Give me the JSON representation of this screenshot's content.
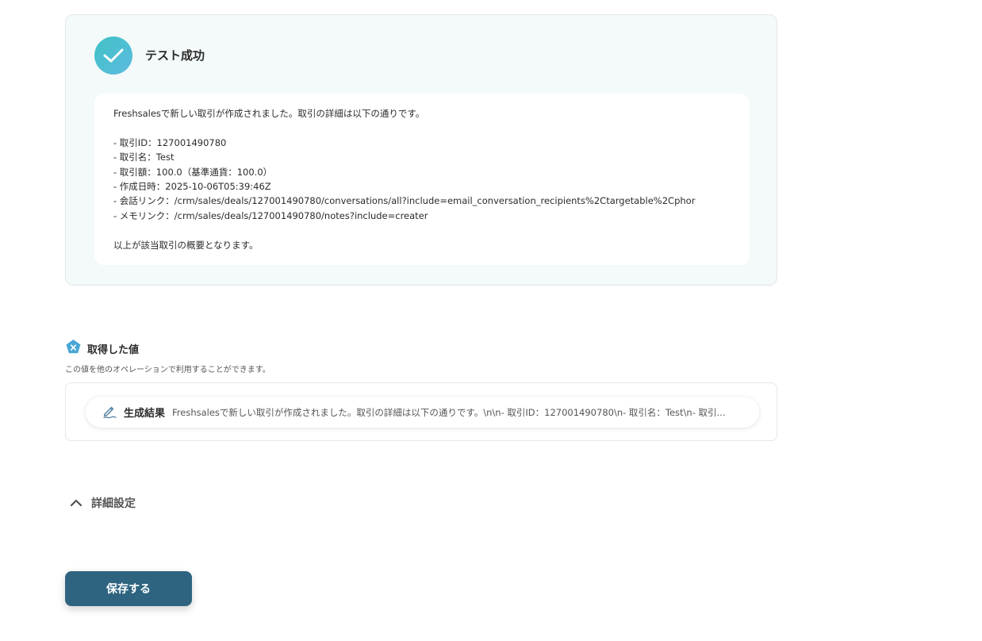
{
  "test_result": {
    "title": "テスト成功",
    "lines": [
      "Freshsalesで新しい取引が作成されました。取引の詳細は以下の通りです。",
      "",
      "- 取引ID：127001490780",
      "- 取引名：Test",
      "- 取引額：100.0（基準通貨：100.0）",
      "- 作成日時：2025-10-06T05:39:46Z",
      "- 会話リンク：/crm/sales/deals/127001490780/conversations/all?include=email_conversation_recipients%2Ctargetable%2Cphor",
      "- メモリンク：/crm/sales/deals/127001490780/notes?include=creater",
      "",
      "以上が該当取引の概要となります。"
    ]
  },
  "acquired_values": {
    "title": "取得した値",
    "description": "この値を他のオペレーションで利用することができます。",
    "items": [
      {
        "name": "生成結果",
        "value": "Freshsalesで新しい取引が作成されました。取引の詳細は以下の通りです。\\n\\n- 取引ID：127001490780\\n- 取引名：Test\\n- 取引..."
      }
    ]
  },
  "advanced": {
    "label": "詳細設定"
  },
  "save_button": {
    "label": "保存する"
  },
  "colors": {
    "accent": "#2e6480",
    "success_gradient_start": "#3fc2c5",
    "success_gradient_end": "#5dbbe0",
    "card_background": "#f4f9f9"
  },
  "icons": {
    "success": "check-icon",
    "section": "variable-x-icon",
    "value": "pen-icon",
    "toggle": "chevron-up-icon"
  }
}
